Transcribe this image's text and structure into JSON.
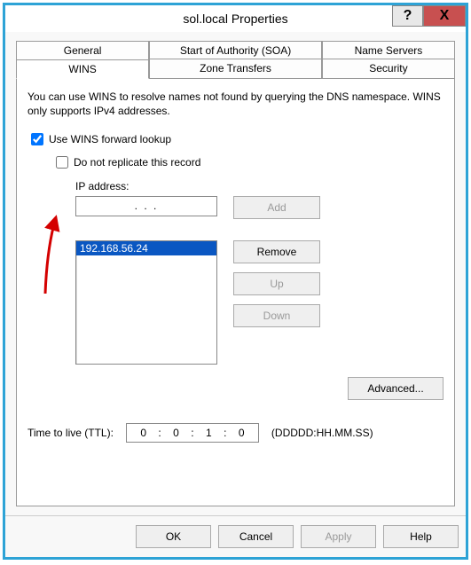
{
  "window": {
    "title": "sol.local Properties"
  },
  "tabs": {
    "top": [
      "General",
      "Start of Authority (SOA)",
      "Name Servers"
    ],
    "bottom": [
      "WINS",
      "Zone Transfers",
      "Security"
    ],
    "active": "WINS"
  },
  "wins": {
    "description": "You can use WINS to resolve names not found by querying the DNS namespace.  WINS only supports IPv4 addresses.",
    "use_wins_label": "Use WINS forward lookup",
    "use_wins_checked": true,
    "do_not_replicate_label": "Do not replicate this record",
    "do_not_replicate_checked": false,
    "ip_label": "IP address:",
    "ip_input_value": ".       .       .",
    "add_label": "Add",
    "list": [
      "192.168.56.24"
    ],
    "remove_label": "Remove",
    "up_label": "Up",
    "down_label": "Down",
    "advanced_label": "Advanced...",
    "ttl_label": "Time to live (TTL):",
    "ttl_d": "0",
    "ttl_h": "0",
    "ttl_m": "1",
    "ttl_s": "0",
    "ttl_format": "(DDDDD:HH.MM.SS)"
  },
  "footer": {
    "ok": "OK",
    "cancel": "Cancel",
    "apply": "Apply",
    "help": "Help"
  }
}
